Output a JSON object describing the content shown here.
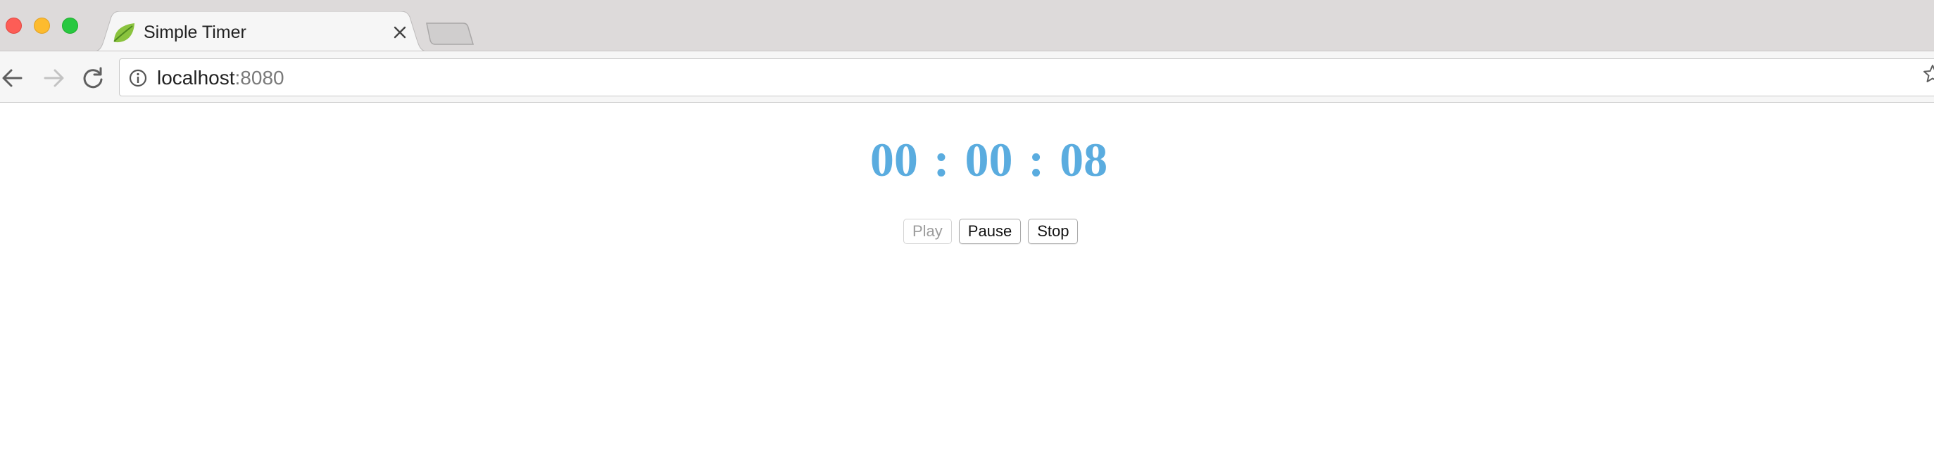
{
  "window": {
    "tab": {
      "title": "Simple Timer"
    },
    "address_bar": {
      "host": "localhost",
      "port": ":8080"
    }
  },
  "timer": {
    "hours": "00",
    "minutes": "00",
    "seconds": "08",
    "separator": ":"
  },
  "controls": {
    "play_label": "Play",
    "pause_label": "Pause",
    "stop_label": "Stop"
  },
  "colors": {
    "timer_text": "#5aacdf",
    "tabstrip_bg": "#dddada",
    "toolbar_bg": "#f6f6f6"
  },
  "icons": [
    "close-window-icon",
    "minimize-window-icon",
    "maximize-window-icon",
    "leaf-favicon-icon",
    "close-tab-icon",
    "back-arrow-icon",
    "forward-arrow-icon",
    "reload-icon",
    "info-icon",
    "bookmark-star-icon"
  ]
}
